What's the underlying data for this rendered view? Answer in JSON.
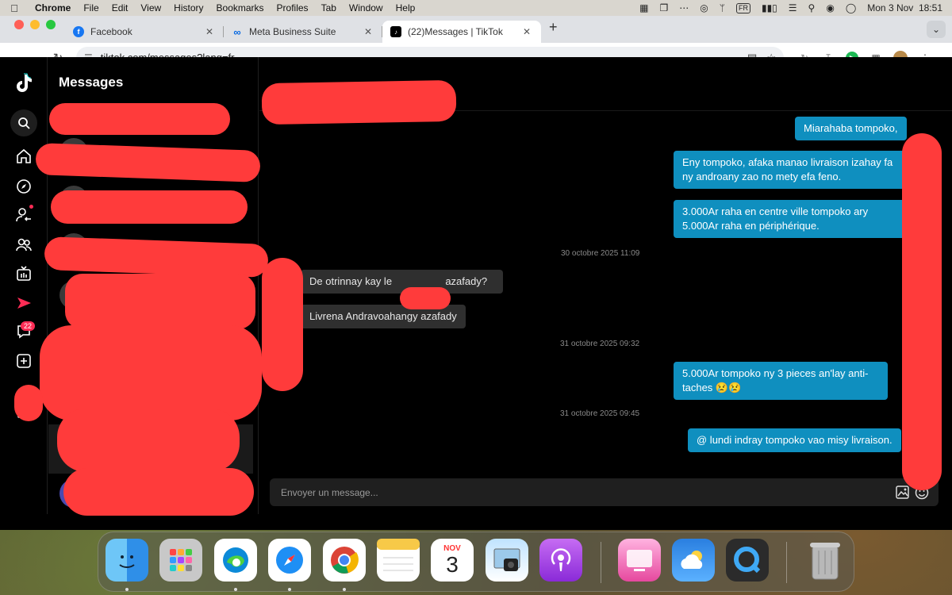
{
  "menubar": {
    "app_name": "Chrome",
    "items": [
      "File",
      "Edit",
      "View",
      "History",
      "Bookmarks",
      "Profiles",
      "Tab",
      "Window",
      "Help"
    ],
    "input_source": "FR",
    "datetime": "Mon 3 Nov  18:51"
  },
  "browser": {
    "tabs": [
      {
        "title": "Facebook",
        "icon": "facebook-icon",
        "active": false
      },
      {
        "title": "Meta Business Suite",
        "icon": "meta-icon",
        "active": false
      },
      {
        "title": "(22)Messages | TikTok",
        "icon": "tiktok-icon",
        "active": true
      }
    ],
    "url": "tiktok.com/messages?lang=fr"
  },
  "rail": {
    "inbox_badge": "22"
  },
  "conversations": {
    "title": "Messages"
  },
  "chat": {
    "messages": [
      {
        "dir": "out",
        "text": "Miarahaba tompoko,"
      },
      {
        "dir": "out",
        "text": "Eny tompoko, afaka manao livraison izahay fa ny androany zao no mety efa feno."
      },
      {
        "dir": "out",
        "text": "3.000Ar raha en centre ville tompoko ary 5.000Ar raha en périphérique."
      },
      {
        "dir": "time",
        "text": "30 octobre 2025 11:09"
      },
      {
        "dir": "in",
        "text_before": "De otrinnay kay le",
        "text_after": "azafady?"
      },
      {
        "dir": "in",
        "text": "Livrena Andravoahangy azafady"
      },
      {
        "dir": "time",
        "text": "31 octobre 2025 09:32"
      },
      {
        "dir": "out",
        "text": "5.000Ar tompoko ny 3 pieces an'lay anti-taches 😢😢"
      },
      {
        "dir": "time",
        "text": "31 octobre 2025 09:45"
      },
      {
        "dir": "out",
        "text": "@ lundi indray tompoko vao misy livraison."
      }
    ],
    "composer_placeholder": "Envoyer un message..."
  },
  "dock": {
    "apps": [
      "Finder",
      "Launchpad",
      "Microsoft Edge",
      "Safari",
      "Google Chrome",
      "Notes",
      "Calendar",
      "Preview",
      "Podcasts",
      "CleanMyMac",
      "Weather",
      "QuickTime Player",
      "Trash"
    ],
    "calendar_month": "NOV",
    "calendar_day": "3"
  },
  "colors": {
    "tiktok_accent": "#fe2c55",
    "outgoing_bubble": "#0f8fbf",
    "incoming_bubble": "#2f2f2f",
    "redaction": "#ff3b3b"
  }
}
